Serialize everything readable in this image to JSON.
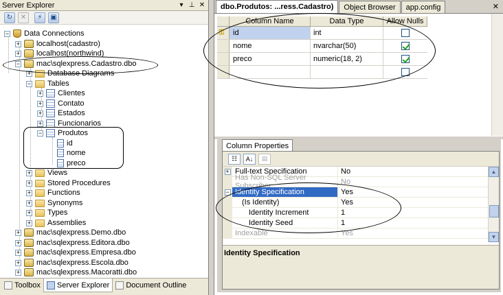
{
  "server_explorer": {
    "title": "Server Explorer",
    "title_buttons": [
      "▾",
      "📌",
      "✕"
    ],
    "toolbar_icons": [
      "refresh-icon",
      "stop-icon",
      "connect-to-database-icon",
      "connect-to-server-icon"
    ],
    "tree": {
      "data_connections": "Data Connections",
      "connections": [
        "localhost(cadastro)",
        "localhost(northwind)",
        "mac\\sqlexpress.Cadastro.dbo"
      ],
      "cadastro_children": [
        "Database Diagrams",
        "Tables"
      ],
      "tables": [
        "Clientes",
        "Contato",
        "Estados",
        "Funcionarios",
        "Produtos"
      ],
      "produtos_columns": [
        "id",
        "nome",
        "preco"
      ],
      "other_folders": [
        "Views",
        "Stored Procedures",
        "Functions",
        "Synonyms",
        "Types",
        "Assemblies"
      ],
      "other_connections": [
        "mac\\sqlexpress.Demo.dbo",
        "mac\\sqlexpress.Editora.dbo",
        "mac\\sqlexpress.Empresa.dbo",
        "mac\\sqlexpress.Escola.dbo",
        "mac\\sqlexpress.Macoratti.dbo"
      ]
    },
    "bottom_tabs": [
      "Toolbox",
      "Server Explorer",
      "Document Outline"
    ],
    "active_bottom_tab": "Server Explorer"
  },
  "document_tabs": {
    "items": [
      "dbo.Produtos: ...ress.Cadastro)",
      "Object Browser",
      "app.config"
    ],
    "active": "dbo.Produtos: ...ress.Cadastro)",
    "close": "✕"
  },
  "table_designer": {
    "headers": [
      "Column Name",
      "Data Type",
      "Allow Nulls"
    ],
    "rows": [
      {
        "name": "id",
        "type": "int",
        "allow_nulls": false,
        "primary_key": true
      },
      {
        "name": "nome",
        "type": "nvarchar(50)",
        "allow_nulls": true,
        "primary_key": false
      },
      {
        "name": "preco",
        "type": "numeric(18, 2)",
        "allow_nulls": true,
        "primary_key": false
      },
      {
        "name": "",
        "type": "",
        "allow_nulls": false,
        "primary_key": false
      }
    ]
  },
  "column_properties": {
    "tab_label": "Column Properties",
    "toolbar_icons": [
      "categorized-icon",
      "alphabetical-icon",
      "property-pages-icon"
    ],
    "rows": [
      {
        "expander": "+",
        "name": "Full-text Specification",
        "value": "No",
        "state": "normal"
      },
      {
        "expander": "",
        "name": "Has Non-SQL Server Subscriber",
        "value": "No",
        "state": "dim"
      },
      {
        "expander": "−",
        "name": "Identity Specification",
        "value": "Yes",
        "state": "selected"
      },
      {
        "expander": "",
        "name": "(Is Identity)",
        "value": "Yes",
        "state": "child"
      },
      {
        "expander": "",
        "name": "Identity Increment",
        "value": "1",
        "state": "child"
      },
      {
        "expander": "",
        "name": "Identity Seed",
        "value": "1",
        "state": "child"
      },
      {
        "expander": "",
        "name": "Indexable",
        "value": "Yes",
        "state": "dim"
      }
    ],
    "description": "Identity Specification"
  }
}
